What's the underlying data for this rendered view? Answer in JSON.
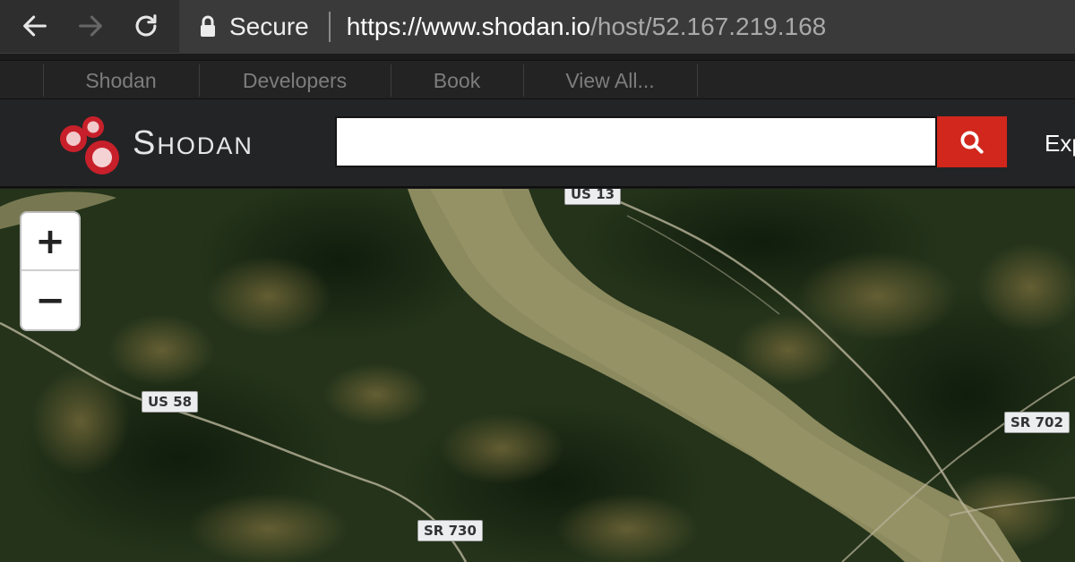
{
  "browser": {
    "back_icon": "arrow-left-icon",
    "forward_icon": "arrow-right-icon",
    "reload_icon": "reload-icon",
    "lock_icon": "lock-icon",
    "secure_label": "Secure",
    "url_base": "https://www.shodan.io",
    "url_path": "/host/52.167.219.168"
  },
  "top_links": [
    {
      "label": "Shodan"
    },
    {
      "label": "Developers"
    },
    {
      "label": "Book"
    },
    {
      "label": "View All..."
    }
  ],
  "header": {
    "logo_text": "Shodan",
    "search_placeholder": "",
    "search_icon": "search-icon",
    "explore_label": "Exp"
  },
  "map": {
    "zoom_in_label": "+",
    "zoom_out_label": "−",
    "road_labels": {
      "us13": "US 13",
      "us58": "US 58",
      "sr702": "SR 702",
      "sr730": "SR 730"
    }
  },
  "colors": {
    "accent_red": "#d2271c",
    "header_bg": "#232426",
    "logo_red": "#c8202a"
  }
}
